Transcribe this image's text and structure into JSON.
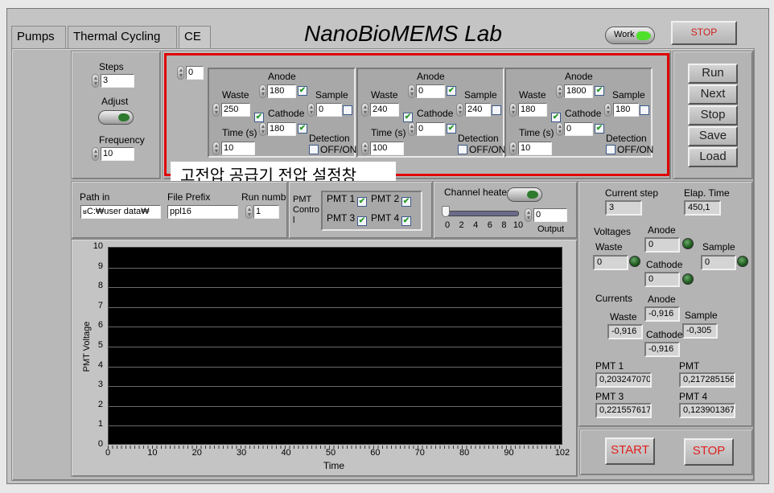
{
  "tabs": [
    {
      "label": "Pumps"
    },
    {
      "label": "Thermal Cycling"
    },
    {
      "label": "CE",
      "active": true
    }
  ],
  "header": {
    "title": "NanoBioMEMS Lab",
    "work_label": "Work",
    "stop_label": "STOP"
  },
  "steps_panel": {
    "steps_label": "Steps",
    "steps_value": "3",
    "adjust_label": "Adjust",
    "frequency_label": "Frequency",
    "frequency_value": "10"
  },
  "step_index": "0",
  "step_groups": [
    {
      "anode_label": "Anode",
      "anode": "180",
      "anode_checked": true,
      "waste_label": "Waste",
      "waste": "250",
      "waste_checked": true,
      "cathode_label": "Cathode",
      "cathode": "180",
      "cathode_checked": true,
      "sample_label": "Sample",
      "sample": "0",
      "sample_checked": false,
      "time_label": "Time (s)",
      "time": "10",
      "detection_label": "Detection",
      "detection_toggle_label": "OFF/ON",
      "detection_checked": false
    },
    {
      "anode_label": "Anode",
      "anode": "0",
      "anode_checked": true,
      "waste_label": "Waste",
      "waste": "240",
      "waste_checked": true,
      "cathode_label": "Cathode",
      "cathode": "0",
      "cathode_checked": true,
      "sample_label": "Sample",
      "sample": "240",
      "sample_checked": false,
      "time_label": "Time (s)",
      "time": "100",
      "detection_label": "Detection",
      "detection_toggle_label": "OFF/ON",
      "detection_checked": false
    },
    {
      "anode_label": "Anode",
      "anode": "1800",
      "anode_checked": true,
      "waste_label": "Waste",
      "waste": "180",
      "waste_checked": true,
      "cathode_label": "Cathode",
      "cathode": "0",
      "cathode_checked": true,
      "sample_label": "Sample",
      "sample": "180",
      "sample_checked": false,
      "time_label": "Time (s)",
      "time": "10",
      "detection_label": "Detection",
      "detection_toggle_label": "OFF/ON",
      "detection_checked": false
    }
  ],
  "annotation": {
    "text": "고전압 공급기 전압 설정창",
    "highlight_color": "#e00000"
  },
  "side_buttons": [
    "Run",
    "Next",
    "Stop",
    "Save",
    "Load"
  ],
  "file": {
    "path_label": "Path in",
    "path_value": "C:₩user data₩",
    "prefix_label": "File Prefix",
    "prefix_value": "ppl16",
    "run_label": "Run number",
    "run_value": "1"
  },
  "pmt_control": {
    "label": "PMT Contro l",
    "items": [
      {
        "label": "PMT 1",
        "checked": true
      },
      {
        "label": "PMT 2",
        "checked": true
      },
      {
        "label": "PMT 3",
        "checked": true
      },
      {
        "label": "PMT 4",
        "checked": true
      }
    ]
  },
  "heater": {
    "label": "Channel heater",
    "slider_value": 0,
    "slider_ticks": [
      "0",
      "2",
      "4",
      "6",
      "8",
      "10"
    ],
    "output_label": "Output",
    "output_value": "0"
  },
  "status": {
    "current_step_label": "Current step",
    "current_step": "3",
    "elapsed_label": "Elap. Time",
    "elapsed": "450,1",
    "voltages_label": "Voltages",
    "v_anode_label": "Anode",
    "v_anode": "0",
    "v_waste_label": "Waste",
    "v_waste": "0",
    "v_sample_label": "Sample",
    "v_sample": "0",
    "v_cathode_label": "Cathode",
    "v_cathode": "0",
    "currents_label": "Currents",
    "c_anode_label": "Anode",
    "c_anode": "-0,916",
    "c_waste_label": "Waste",
    "c_waste": "-0,916",
    "c_sample_label": "Sample",
    "c_sample": "-0,305",
    "c_cathode_label": "Cathode",
    "c_cathode": "-0,916",
    "pmt1_label": "PMT 1",
    "pmt1": "0,203247070",
    "pmt2_label": "PMT",
    "pmt2": "0,217285156",
    "pmt3_label": "PMT 3",
    "pmt3": "0,221557617",
    "pmt4_label": "PMT 4",
    "pmt4": "0,123901367"
  },
  "bottom_buttons": {
    "start_label": "START",
    "stop_label": "STOP"
  },
  "chart_data": {
    "type": "line",
    "title": "",
    "xlabel": "Time",
    "ylabel": "PMT Voltage",
    "xlim": [
      0,
      102
    ],
    "ylim": [
      0,
      10
    ],
    "x_ticks": [
      "0",
      "10",
      "20",
      "30",
      "40",
      "50",
      "60",
      "70",
      "80",
      "90",
      "102"
    ],
    "y_ticks": [
      "0",
      "1",
      "2",
      "3",
      "4",
      "5",
      "6",
      "7",
      "8",
      "9",
      "10"
    ],
    "grid": true,
    "background": "#000000",
    "series": []
  }
}
